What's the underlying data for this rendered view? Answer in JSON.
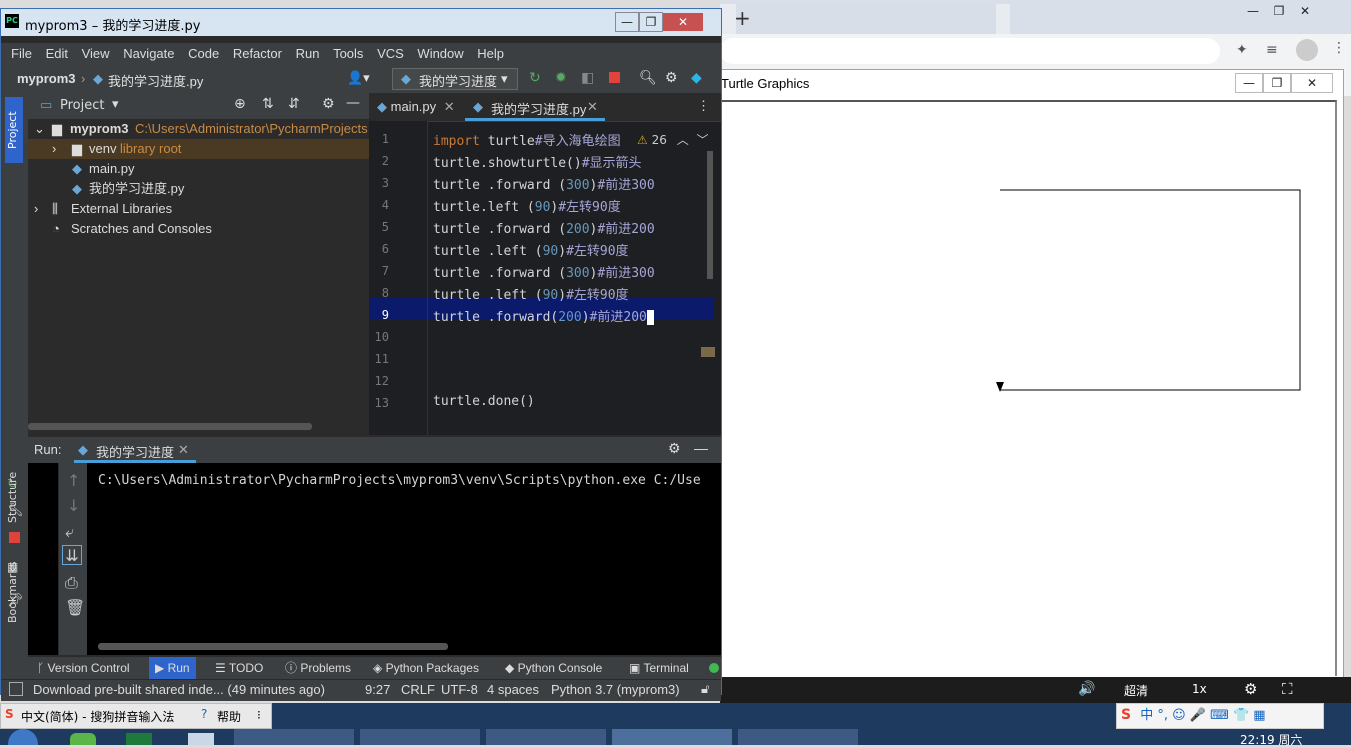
{
  "pycharm": {
    "window_title": "myprom3 – 我的学习进度.py",
    "menu": [
      "File",
      "Edit",
      "View",
      "Navigate",
      "Code",
      "Refactor",
      "Run",
      "Tools",
      "VCS",
      "Window",
      "Help"
    ],
    "breadcrumb": {
      "project": "myprom3",
      "file": "我的学习进度.py"
    },
    "run_config": "我的学习进度",
    "project_panel": {
      "title": "Project",
      "root_name": "myprom3",
      "root_path": "C:\\Users\\Administrator\\PycharmProjects",
      "venv": "venv",
      "venv_note": "library root",
      "files": [
        "main.py",
        "我的学习进度.py"
      ],
      "external": "External Libraries",
      "scratches": "Scratches and Consoles"
    },
    "editor": {
      "tabs": [
        "main.py",
        "我的学习进度.py"
      ],
      "warning_count": "26",
      "line_numbers": [
        "1",
        "2",
        "3",
        "4",
        "5",
        "6",
        "7",
        "8",
        "9",
        "10",
        "11",
        "12",
        "13"
      ]
    },
    "side_labels": {
      "project": "Project",
      "structure": "Structure",
      "bookmarks": "Bookmarks"
    },
    "run": {
      "label": "Run:",
      "tab": "我的学习进度",
      "output": "C:\\Users\\Administrator\\PycharmProjects\\myprom3\\venv\\Scripts\\python.exe C:/Use"
    },
    "bottom_tools": [
      "Version Control",
      "Run",
      "TODO",
      "Problems",
      "Python Packages",
      "Python Console",
      "Terminal"
    ],
    "status": {
      "message": "Download pre-built shared inde... (49 minutes ago)",
      "position": "9:27",
      "line_sep": "CRLF",
      "encoding": "UTF-8",
      "indent": "4 spaces",
      "interpreter": "Python 3.7 (myprom3)"
    }
  },
  "turtle": {
    "title": "Turtle Graphics"
  },
  "media_bar": {
    "quality": "超清",
    "speed": "1x"
  },
  "ime": {
    "label": "中文(简体) - 搜狗拼音输入法",
    "help": "帮助"
  },
  "taskbar": {
    "time": "22:19 周六"
  }
}
